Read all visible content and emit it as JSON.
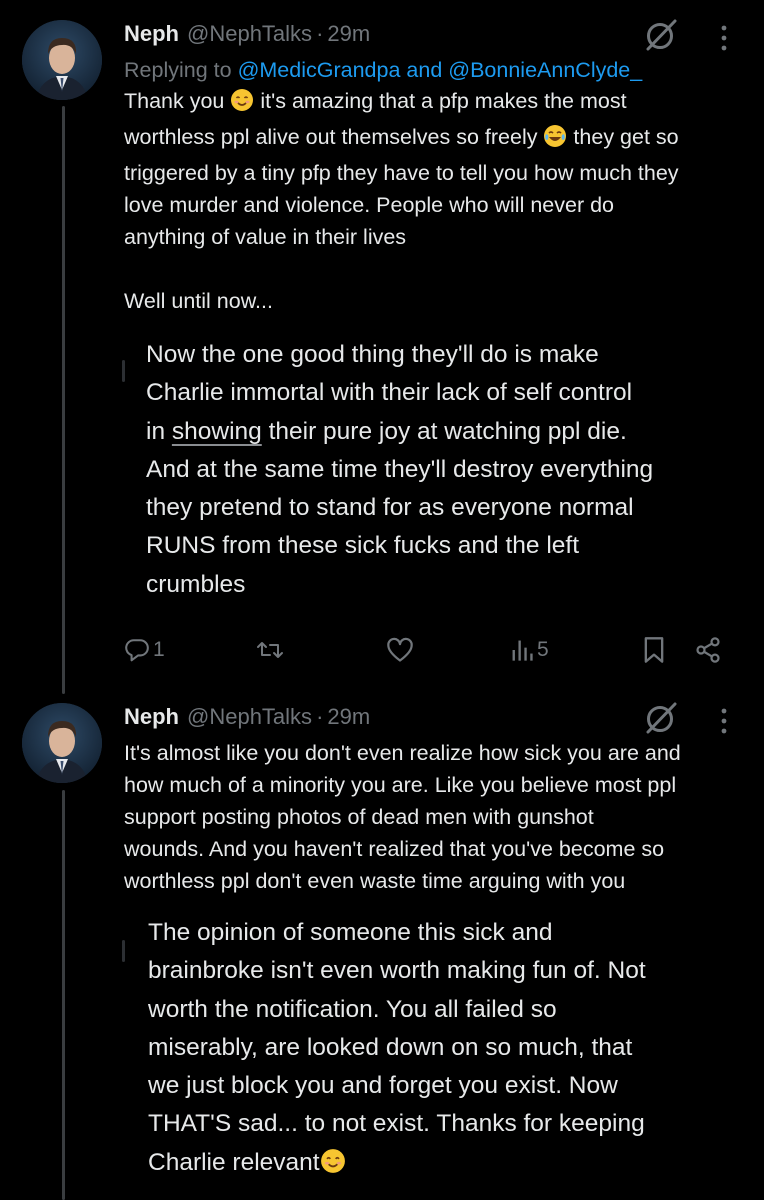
{
  "colors": {
    "background": "#000000",
    "text_primary": "#e7e9ea",
    "text_secondary": "#71767b",
    "link_blue": "#1d9bf0",
    "thread_line": "#3a3d40"
  },
  "tweet1": {
    "avatar_icon": "profile-photo",
    "display_name": "Neph",
    "handle": "@NephTalks",
    "separator": "·",
    "time": "29m",
    "grok_icon": "grok-icon",
    "more_icon": "more-vertical-icon",
    "reply_prefix": "Replying to",
    "reply_mention_1": "@MedicGrandpa",
    "reply_and": "and",
    "reply_mention_2": "@BonnieAnnClyde_",
    "text_line1_a": "Thank you",
    "text_line1_b": " it's amazing that a pfp makes the most",
    "text_line2_a": "worthless ppl alive out themselves so freely",
    "text_line2_b": " they get so",
    "text_rest": "triggered by a tiny pfp they have to tell you how much they\nlove murder and violence. People who will never do\nanything of value in their lives\n\nWell until now...",
    "emoji_1": "smiling-face-emoji",
    "emoji_2": "tears-of-joy-emoji",
    "quote_line1": "Now the one good thing they'll do is make",
    "quote_line2": "Charlie immortal with their lack of self control",
    "quote_line3_a": "in ",
    "quote_line3_b": "showing",
    "quote_line3_c": " their pure joy at watching ppl die.",
    "quote_rest": "And at the same time they'll destroy everything\nthey pretend to stand for as everyone normal\nRUNS from these sick fucks and the left\ncrumbles",
    "actions": {
      "reply_icon": "reply-icon",
      "reply_count": "1",
      "retweet_icon": "retweet-icon",
      "like_icon": "heart-icon",
      "views_icon": "views-icon",
      "views_count": "5",
      "bookmark_icon": "bookmark-icon",
      "share_icon": "share-icon"
    }
  },
  "tweet2": {
    "avatar_icon": "profile-photo",
    "display_name": "Neph",
    "handle": "@NephTalks",
    "separator": "·",
    "time": "29m",
    "grok_icon": "grok-icon",
    "more_icon": "more-vertical-icon",
    "text": "It's almost like you don't even realize how sick you are and\nhow much of a minority you are. Like you believe most ppl\nsupport posting photos of dead men with gunshot\nwounds. And you haven't realized that you've become so\nworthless ppl don't even waste time arguing with you",
    "quote_text": "The opinion of someone this sick and\nbrainbroke isn't even worth making fun of. Not\nworth the notification. You all failed so\nmiserably, are looked down on so much, that\nwe just block you and forget you exist. Now\nTHAT'S sad... to not exist. Thanks for keeping",
    "quote_last": "Charlie relevant",
    "emoji_end": "smiling-face-emoji"
  }
}
